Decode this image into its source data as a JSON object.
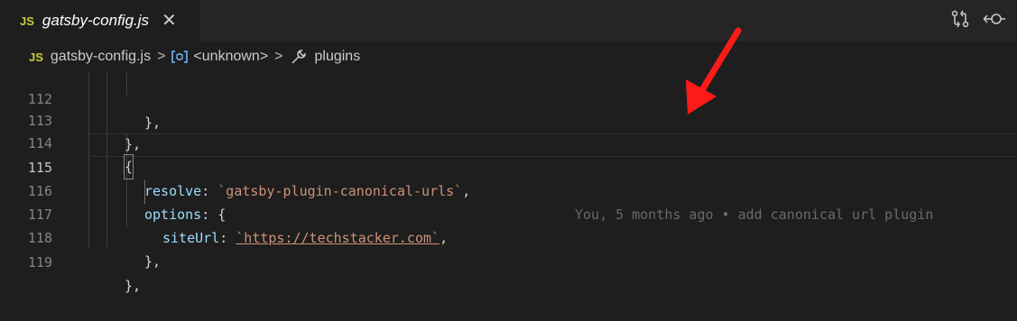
{
  "tab": {
    "badge": "JS",
    "title": "gatsby-config.js",
    "close_glyph": "✕"
  },
  "actions": {
    "icons": [
      "git-compare-icon",
      "go-to-previous-change-icon"
    ]
  },
  "breadcrumbs": {
    "badge": "JS",
    "file": "gatsby-config.js",
    "separator": ">",
    "item1": "<unknown>",
    "item2": "plugins"
  },
  "editor": {
    "lines": [
      {
        "num": "112",
        "text": "},"
      },
      {
        "num": "113",
        "text": "},"
      },
      {
        "num": "114",
        "text": "{"
      },
      {
        "num": "115",
        "key": "resolve",
        "colon": ": ",
        "value": "`gatsby-plugin-canonical-urls`",
        "tail": ",",
        "blame": "You, 5 months ago • add canonical url plugin"
      },
      {
        "num": "116",
        "key": "options",
        "colon": ": ",
        "tail": "{"
      },
      {
        "num": "117",
        "key": "siteUrl",
        "colon": ": ",
        "value": "`https://techstacker.com`",
        "tail": ","
      },
      {
        "num": "118",
        "text": "},"
      },
      {
        "num": "119",
        "text": "},"
      }
    ]
  },
  "colors": {
    "background": "#1e1e1e",
    "tabbar": "#252526",
    "js_badge": "#cbcb41",
    "key": "#9cdcfe",
    "string": "#ce9178",
    "line_number": "#858585",
    "blame": "#6a6a6a",
    "arrow": "#ff1a1a"
  }
}
